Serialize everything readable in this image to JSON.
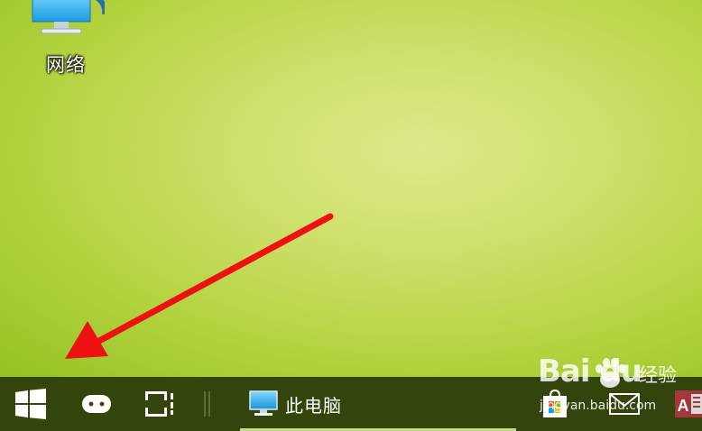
{
  "desktop": {
    "icons": [
      {
        "label": "网络",
        "icon": "network-computer-icon"
      }
    ]
  },
  "taskbar": {
    "start_icon": "windows-logo-icon",
    "search_icon": "cortana-icon",
    "taskview_icon": "task-view-icon",
    "apps": [
      {
        "label": "此电脑",
        "icon": "this-pc-icon",
        "active": true
      }
    ],
    "pinned": [
      "store-icon",
      "mail-icon",
      "access-icon"
    ]
  },
  "watermark": {
    "logo": "Bai du",
    "cn_text": "经验",
    "url": "jingyan.baidu.com"
  },
  "colors": {
    "taskbar": "#33450c",
    "desktop_center": "#dfe98b",
    "desktop_edge": "#95c224",
    "arrow": "#ee1111"
  }
}
